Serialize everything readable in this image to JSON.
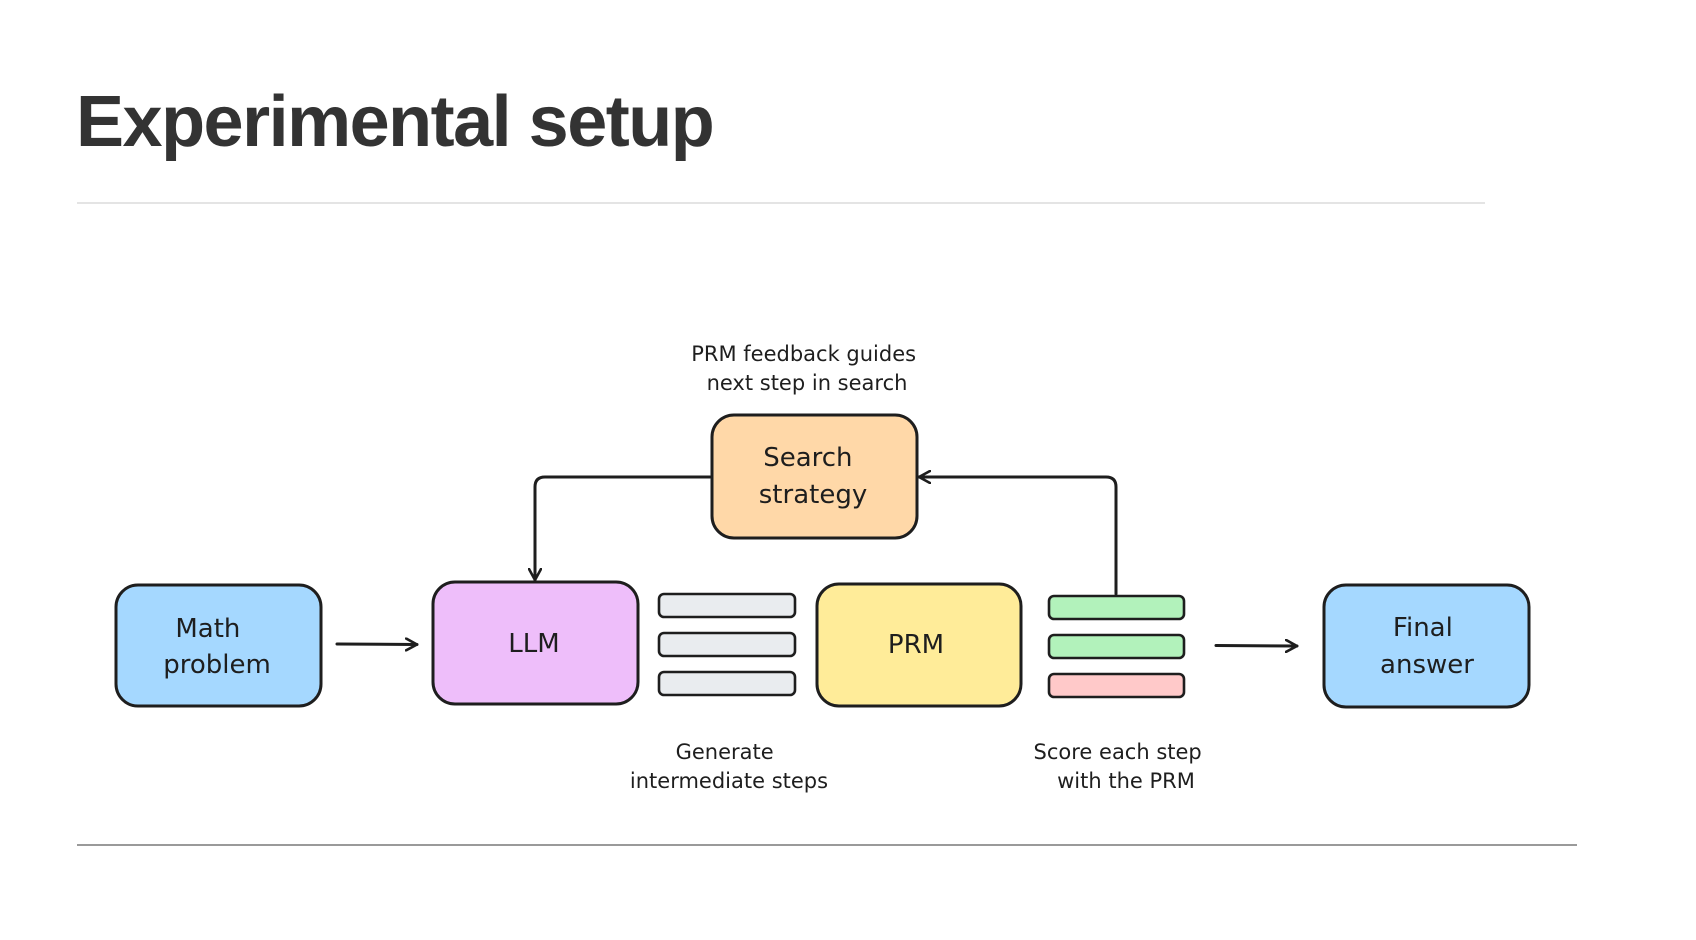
{
  "slide": {
    "title": "Experimental setup"
  },
  "diagram": {
    "nodes": {
      "math_problem": {
        "lines": [
          "Math",
          "problem"
        ],
        "fill": "#a5d8ff"
      },
      "llm": {
        "lines": [
          "LLM"
        ],
        "fill": "#eebefa"
      },
      "prm": {
        "lines": [
          "PRM"
        ],
        "fill": "#ffec99"
      },
      "final_answer": {
        "lines": [
          "Final",
          "answer"
        ],
        "fill": "#a5d8ff"
      },
      "search_strategy": {
        "lines": [
          "Search",
          "strategy"
        ],
        "fill": "#ffd8a8"
      }
    },
    "generated_steps": {
      "count": 3,
      "fill": "#e9ecef"
    },
    "scored_steps": {
      "items": [
        {
          "status": "good",
          "fill": "#b2f2bb"
        },
        {
          "status": "good",
          "fill": "#b2f2bb"
        },
        {
          "status": "bad",
          "fill": "#ffc9c9"
        }
      ]
    },
    "annotations": {
      "feedback": [
        "PRM feedback guides",
        "next step in search"
      ],
      "generate": [
        "Generate",
        "intermediate steps"
      ],
      "score": [
        "Score each step",
        "with the PRM"
      ]
    },
    "colors": {
      "stroke": "#1e1e1e",
      "title": "#333333"
    }
  }
}
